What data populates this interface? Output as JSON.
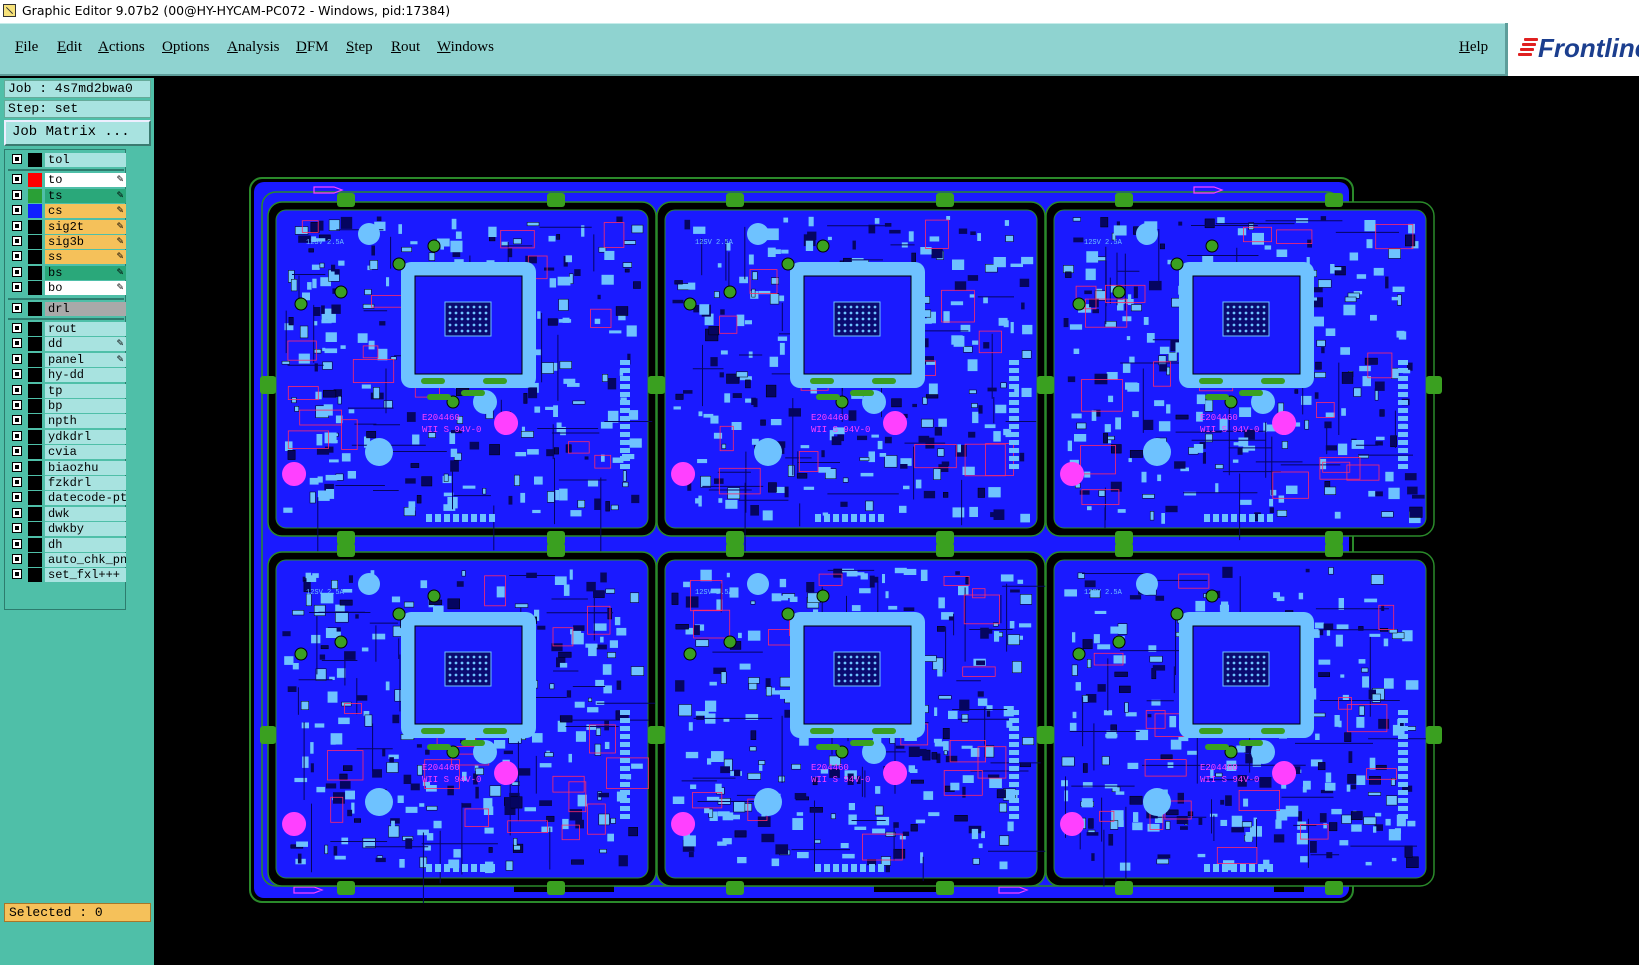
{
  "window": {
    "title": "Graphic Editor 9.07b2 (00@HY-HYCAM-PC072 - Windows, pid:17384)"
  },
  "menu": {
    "items": [
      "File",
      "Edit",
      "Actions",
      "Options",
      "Analysis",
      "DFM",
      "Step",
      "Rout",
      "Windows"
    ],
    "help": "Help"
  },
  "brand": {
    "name": "Frontline",
    "stripe_color": "#e02020",
    "text_color": "#1b3e8e"
  },
  "job": {
    "job_label": "Job : 4s7md2bwa0",
    "step_label": "Step: set",
    "matrix_button": "Job Matrix ..."
  },
  "layers": [
    {
      "name": "tol",
      "color": "#000000",
      "bg": "#a8e3e0",
      "editable": false,
      "group": 1
    },
    {
      "name": "to",
      "color": "#ff0000",
      "bg": "#ffffff",
      "editable": true,
      "active": true,
      "group": 2
    },
    {
      "name": "ts",
      "color": "#2aa036",
      "bg": "#2aa87a",
      "editable": true,
      "group": 2
    },
    {
      "name": "cs",
      "color": "#1020ff",
      "bg": "#f5c15a",
      "editable": true,
      "group": 2
    },
    {
      "name": "sig2t",
      "color": "#000000",
      "bg": "#f5c15a",
      "editable": true,
      "group": 2
    },
    {
      "name": "sig3b",
      "color": "#000000",
      "bg": "#f5c15a",
      "editable": true,
      "group": 2
    },
    {
      "name": "ss",
      "color": "#000000",
      "bg": "#f5c15a",
      "editable": true,
      "group": 2
    },
    {
      "name": "bs",
      "color": "#000000",
      "bg": "#2aa87a",
      "editable": true,
      "group": 2
    },
    {
      "name": "bo",
      "color": "#000000",
      "bg": "#ffffff",
      "editable": true,
      "group": 2
    },
    {
      "name": "drl",
      "color": "#000000",
      "bg": "#a9a9a9",
      "editable": false,
      "group": 3
    },
    {
      "name": "rout",
      "color": "#000000",
      "bg": "#a8e3e0",
      "editable": false,
      "group": 4
    },
    {
      "name": "dd",
      "color": "#000000",
      "bg": "#a8e3e0",
      "editable": true,
      "group": 4
    },
    {
      "name": "panel",
      "color": "#000000",
      "bg": "#a8e3e0",
      "editable": true,
      "group": 4
    },
    {
      "name": "hy-dd",
      "color": "#000000",
      "bg": "#a8e3e0",
      "editable": false,
      "group": 4
    },
    {
      "name": "tp",
      "color": "#000000",
      "bg": "#a8e3e0",
      "editable": false,
      "group": 4
    },
    {
      "name": "bp",
      "color": "#000000",
      "bg": "#a8e3e0",
      "editable": false,
      "group": 4
    },
    {
      "name": "npth",
      "color": "#000000",
      "bg": "#a8e3e0",
      "editable": false,
      "group": 4
    },
    {
      "name": "ydkdrl",
      "color": "#000000",
      "bg": "#a8e3e0",
      "editable": false,
      "group": 4
    },
    {
      "name": "cvia",
      "color": "#000000",
      "bg": "#a8e3e0",
      "editable": false,
      "group": 4
    },
    {
      "name": "biaozhu",
      "color": "#000000",
      "bg": "#a8e3e0",
      "editable": false,
      "group": 4
    },
    {
      "name": "fzkdrl",
      "color": "#000000",
      "bg": "#a8e3e0",
      "editable": false,
      "group": 4
    },
    {
      "name": "datecode-pt",
      "color": "#000000",
      "bg": "#a8e3e0",
      "editable": false,
      "group": 4
    },
    {
      "name": "dwk",
      "color": "#000000",
      "bg": "#a8e3e0",
      "editable": false,
      "group": 4
    },
    {
      "name": "dwkby",
      "color": "#000000",
      "bg": "#a8e3e0",
      "editable": false,
      "group": 4
    },
    {
      "name": "dh",
      "color": "#000000",
      "bg": "#a8e3e0",
      "editable": false,
      "group": 4
    },
    {
      "name": "auto_chk_pn",
      "color": "#000000",
      "bg": "#a8e3e0",
      "editable": false,
      "group": 4
    },
    {
      "name": "set_fxl+++",
      "color": "#000000",
      "bg": "#a8e3e0",
      "editable": false,
      "group": 4
    }
  ],
  "status": {
    "selected": "Selected : 0"
  },
  "board": {
    "rows": 2,
    "cols": 3,
    "colors": {
      "background": "#000000",
      "substrate": "#1a1aff",
      "copper": "#6ec2ff",
      "outline": "#2a8a2a",
      "tab": "#3aa020",
      "silk": "#ff2a6a",
      "text": "#ff40ff",
      "trace": "#050560"
    },
    "labels": {
      "cert": "E204460",
      "grade": "WII S 94V-0",
      "power": "12SV 2.5A"
    }
  }
}
